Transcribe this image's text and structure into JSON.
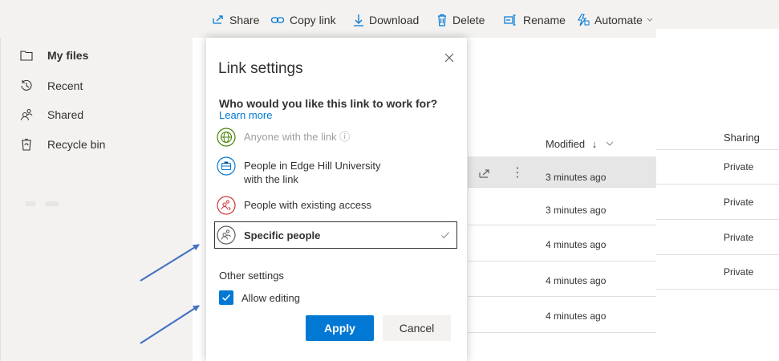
{
  "toolbar": {
    "share": "Share",
    "copy_link": "Copy link",
    "download": "Download",
    "delete": "Delete",
    "rename": "Rename",
    "automate": "Automate"
  },
  "sidebar": {
    "items": [
      {
        "label": "My files",
        "icon": "folder-icon",
        "active": true
      },
      {
        "label": "Recent",
        "icon": "clock-icon"
      },
      {
        "label": "Shared",
        "icon": "people-icon"
      },
      {
        "label": "Recycle bin",
        "icon": "recycle-bin-icon"
      }
    ]
  },
  "list": {
    "col_modified": "Modified",
    "col_sharing": "Sharing",
    "rows": [
      {
        "modified": "3 minutes ago",
        "sharing": "Private"
      },
      {
        "modified": "3 minutes ago",
        "sharing": "Private"
      },
      {
        "modified": "4 minutes ago",
        "sharing": "Private"
      },
      {
        "modified": "4 minutes ago",
        "sharing": "Private"
      },
      {
        "modified": "4 minutes ago",
        "sharing": ""
      }
    ]
  },
  "dialog": {
    "title": "Link settings",
    "question": "Who would you like this link to work for?",
    "learn_more": "Learn more",
    "options": [
      {
        "label": "Anyone with the link",
        "icon": "globe-icon",
        "disabled": true
      },
      {
        "label": "People in Edge Hill University",
        "label2": "with the link",
        "icon": "organization-icon"
      },
      {
        "label": "People with existing access",
        "icon": "people-access-icon"
      },
      {
        "label": "Specific people",
        "icon": "specific-people-icon",
        "selected": true
      }
    ],
    "other_settings": "Other settings",
    "allow_editing": "Allow editing",
    "allow_editing_checked": true,
    "apply": "Apply",
    "cancel": "Cancel"
  },
  "colors": {
    "accent": "#0078d4",
    "arrow": "#4472c4",
    "globe": "#498205",
    "org": "#0078d4",
    "access": "#d13438"
  }
}
